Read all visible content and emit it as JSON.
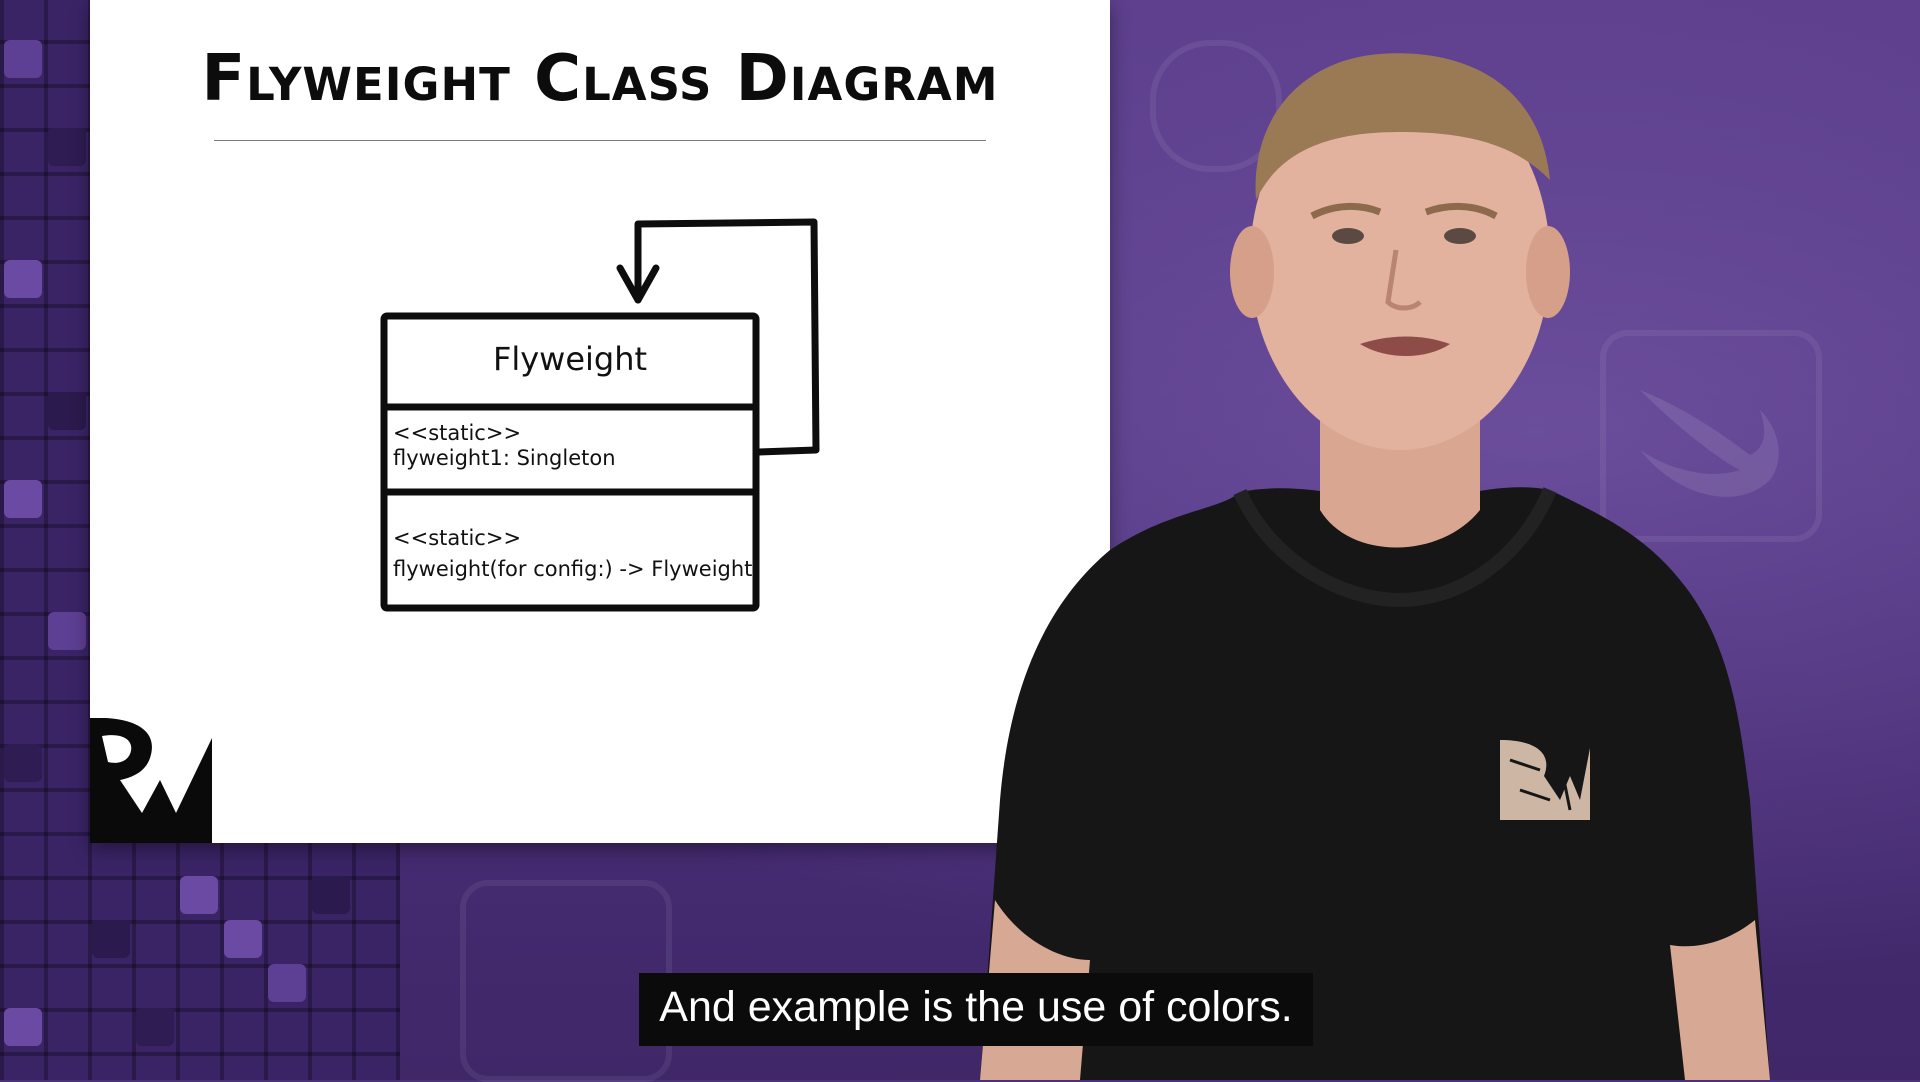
{
  "slide": {
    "title": "Flyweight Class Diagram",
    "uml_class": {
      "name": "Flyweight",
      "attribute_stereotype": "<<static>>",
      "attribute": "flyweight1: Singleton",
      "method_stereotype": "<<static>>",
      "method": "flyweight(for config:) -> Flyweight"
    }
  },
  "caption": "And example is the use of colors.",
  "colors": {
    "background_purple": "#4b2f7a",
    "slide_white": "#ffffff",
    "shirt_black": "#161616",
    "caption_box": "#0b0b0b"
  },
  "icons": [
    "raywenderlich-logo",
    "raywenderlich-shirt-logo",
    "swift-icon"
  ]
}
